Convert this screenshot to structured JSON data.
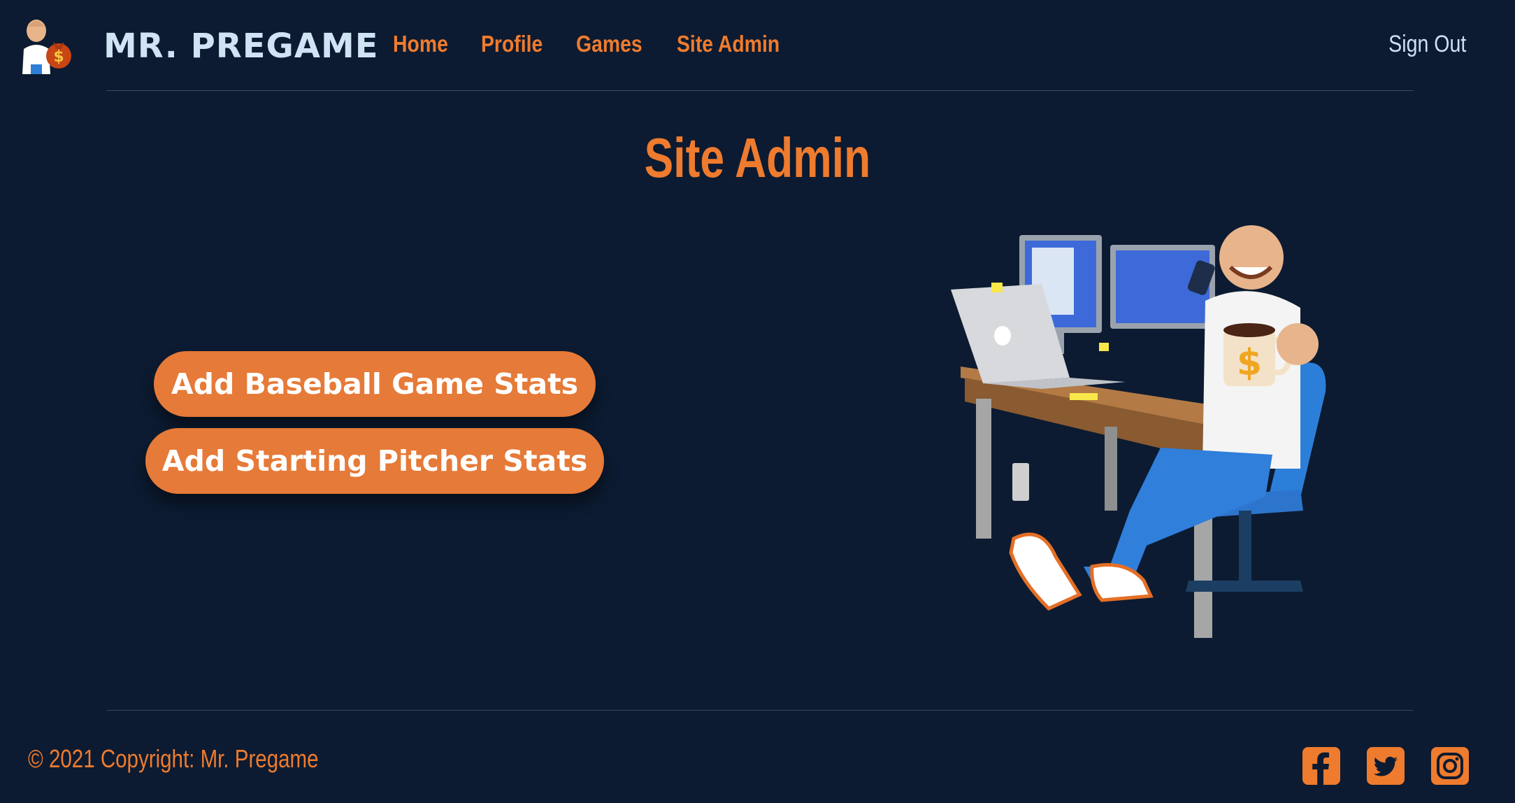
{
  "header": {
    "brand": "MR. PREGAME",
    "nav": [
      "Home",
      "Profile",
      "Games",
      "Site Admin"
    ],
    "sign_out": "Sign Out"
  },
  "main": {
    "title": "Site Admin",
    "buttons": [
      "Add Baseball Game Stats",
      "Add Starting Pitcher Stats"
    ]
  },
  "footer": {
    "copyright": "© 2021 Copyright: Mr. Pregame",
    "social_icons": [
      "facebook-icon",
      "twitter-icon",
      "instagram-icon"
    ]
  },
  "colors": {
    "background": "#0c1b31",
    "accent": "#ef7b2e",
    "brand_text": "#cfe3f5"
  }
}
